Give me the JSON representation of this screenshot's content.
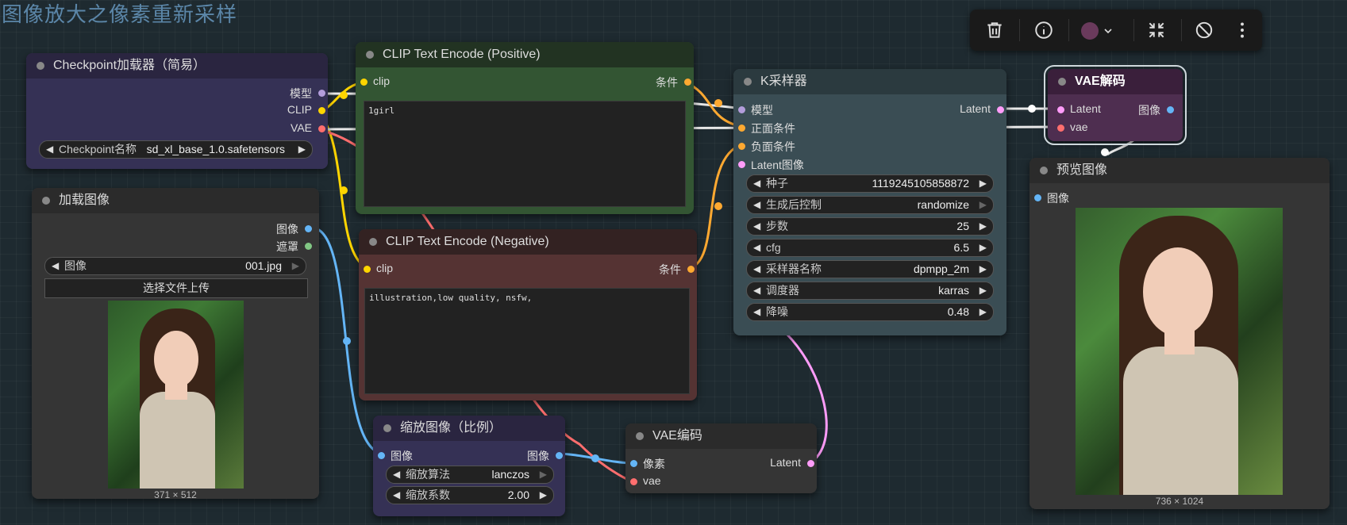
{
  "page_title": "图像放大之像素重新采样",
  "toolbar": {
    "color_swatch": "#6a3a5c",
    "icons": [
      "trash-icon",
      "info-icon",
      "color-swatch",
      "collapse-icon",
      "bypass-icon",
      "more-icon"
    ]
  },
  "checkpoint_loader": {
    "title": "Checkpoint加载器（简易）",
    "outputs": [
      "模型",
      "CLIP",
      "VAE"
    ],
    "widget_label": "Checkpoint名称",
    "widget_value": "sd_xl_base_1.0.safetensors"
  },
  "load_image": {
    "title": "加载图像",
    "outputs": [
      "图像",
      "遮罩"
    ],
    "widget_label": "图像",
    "widget_value": "001.jpg",
    "upload_button": "选择文件上传",
    "size": "371 × 512"
  },
  "clip_pos": {
    "title": "CLIP Text Encode (Positive)",
    "input": "clip",
    "output": "条件",
    "text": "1girl"
  },
  "clip_neg": {
    "title": "CLIP Text Encode (Negative)",
    "input": "clip",
    "output": "条件",
    "text": "illustration,low quality, nsfw,"
  },
  "ksampler": {
    "title": "K采样器",
    "inputs": [
      "模型",
      "正面条件",
      "负面条件",
      "Latent图像"
    ],
    "output": "Latent",
    "widgets": [
      {
        "label": "种子",
        "value": "1119245105858872"
      },
      {
        "label": "生成后控制",
        "value": "randomize"
      },
      {
        "label": "步数",
        "value": "25"
      },
      {
        "label": "cfg",
        "value": "6.5"
      },
      {
        "label": "采样器名称",
        "value": "dpmpp_2m"
      },
      {
        "label": "调度器",
        "value": "karras"
      },
      {
        "label": "降噪",
        "value": "0.48"
      }
    ]
  },
  "vae_decode": {
    "title": "VAE解码",
    "inputs": [
      "Latent",
      "vae"
    ],
    "output": "图像"
  },
  "preview": {
    "title": "预览图像",
    "input": "图像",
    "size": "736 × 1024"
  },
  "scale_image": {
    "title": "缩放图像（比例）",
    "input": "图像",
    "output": "图像",
    "widgets": [
      {
        "label": "缩放算法",
        "value": "lanczos"
      },
      {
        "label": "缩放系数",
        "value": "2.00"
      }
    ]
  },
  "vae_encode": {
    "title": "VAE编码",
    "inputs": [
      "像素",
      "vae"
    ],
    "output": "Latent"
  },
  "colors": {
    "model": "#b39ddb",
    "clip": "#ffd500",
    "vae": "#ff6e6e",
    "conditioning": "#ffa931",
    "latent": "#ff9cf9",
    "image": "#64b5f6",
    "mask": "#81c784"
  }
}
